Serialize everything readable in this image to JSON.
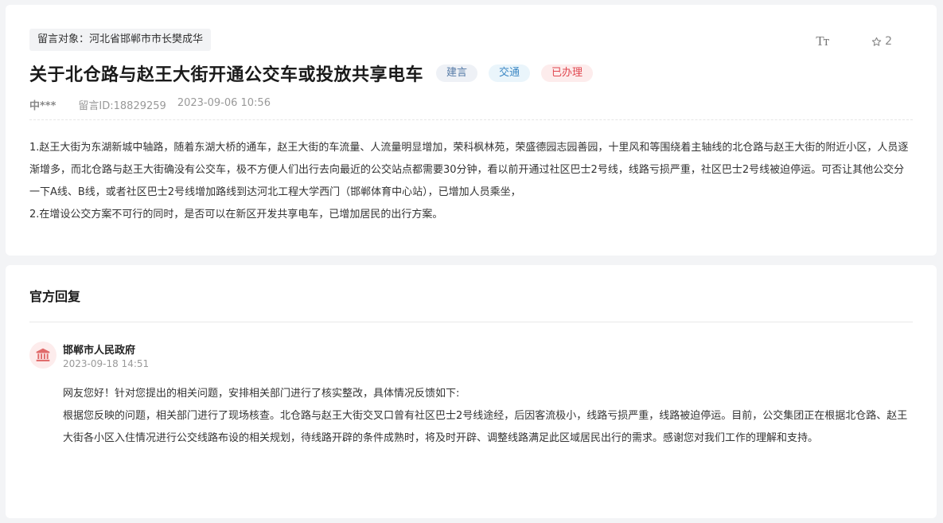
{
  "message": {
    "target": "留言对象：河北省邯郸市市长樊成华",
    "font_size_label": "Tт",
    "favorite_count": "2",
    "title": "关于北仓路与赵王大街开通公交车或投放共享电车",
    "tags": [
      {
        "label": "建言",
        "color": "#557aa6"
      },
      {
        "label": "交通",
        "color": "#3d88c4"
      },
      {
        "label": "已办理",
        "color": "#e0474f"
      }
    ],
    "author": "中***",
    "message_id": "留言ID:18829259",
    "time": "2023-09-06 10:56",
    "paragraphs": [
      "1.赵王大街为东湖新城中轴路，随着东湖大桥的通车，赵王大街的车流量、人流量明显增加，荣科枫林苑，荣盛德园志园善园，十里风和等围绕着主轴线的北仓路与赵王大街的附近小区，人员逐渐增多，而北仓路与赵王大街确没有公交车，极不方便人们出行去向最近的公交站点都需要30分钟，看以前开通过社区巴士2号线，线路亏损严重，社区巴士2号线被迫停运。可否让其他公交分一下A线、B线，或者社区巴士2号线增加路线到达河北工程大学西门（邯郸体育中心站），已增加人员乘坐，",
      "2.在增设公交方案不可行的同时，是否可以在新区开发共享电车，已增加居民的出行方案。"
    ]
  },
  "reply": {
    "heading": "官方回复",
    "org_name": "邯郸市人民政府",
    "org_icon": "government-building-icon",
    "time": "2023-09-18 14:51",
    "paragraphs": [
      "网友您好！针对您提出的相关问题，安排相关部门进行了核实整改，具体情况反馈如下:",
      "根据您反映的问题，相关部门进行了现场核查。北仓路与赵王大街交叉口曾有社区巴士2号线途经，后因客流极小，线路亏损严重，线路被迫停运。目前，公交集团正在根据北仓路、赵王大街各小区入住情况进行公交线路布设的相关规划，待线路开辟的条件成熟时，将及时开辟、调整线路满足此区域居民出行的需求。感谢您对我们工作的理解和支持。"
    ]
  }
}
